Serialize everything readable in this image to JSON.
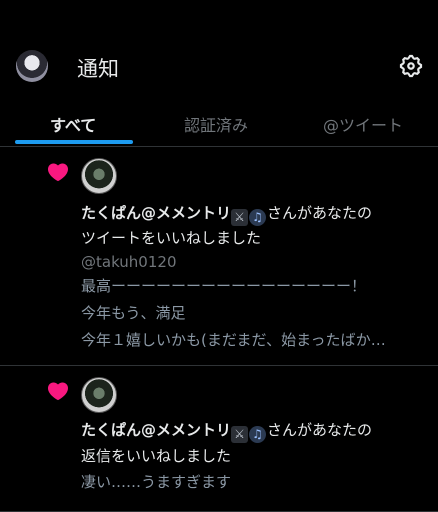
{
  "header": {
    "title": "通知"
  },
  "tabs": [
    {
      "label": "すべて",
      "active": true
    },
    {
      "label": "認証済み",
      "active": false
    },
    {
      "label": "@ツイート",
      "active": false
    }
  ],
  "notifications": [
    {
      "user_name": "たくぱん@メメントリ",
      "emojis": [
        "crossed-swords-icon",
        "music-note-icon"
      ],
      "action_line1_suffix": "さんがあなたの",
      "action_line2": "ツイートをいいねしました",
      "handle": "@takuh0120",
      "text_lines": [
        "最高ーーーーーーーーーーーーーーーー！",
        "今年もう、満足",
        "今年１嬉しいかも(まだまだ、始まったばか…"
      ]
    },
    {
      "user_name": "たくぱん@メメントリ",
      "emojis": [
        "crossed-swords-icon",
        "music-note-icon"
      ],
      "action_line1_suffix": "さんがあなたの",
      "action_line2": "返信をいいねしました",
      "text_lines": [
        "凄い……うますぎます"
      ]
    }
  ],
  "colors": {
    "accent": "#1d9bf0",
    "heart": "#f91880",
    "background": "#000000"
  }
}
